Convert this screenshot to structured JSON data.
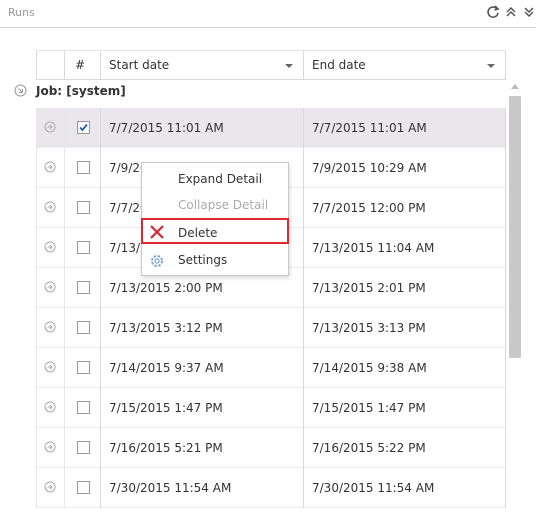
{
  "header": {
    "title": "Runs",
    "icons": [
      "refresh-icon",
      "collapse-all-icon",
      "expand-all-icon"
    ]
  },
  "columns": {
    "num": "#",
    "start_date": "Start date",
    "end_date": "End date"
  },
  "group": {
    "label": "Job: [system]"
  },
  "rows": [
    {
      "start": "7/7/2015 11:01 AM",
      "end": "7/7/2015 11:01 AM",
      "checked": true,
      "selected": true
    },
    {
      "start": "7/9/2015 10:29 AM",
      "end": "7/9/2015 10:29 AM",
      "checked": false
    },
    {
      "start": "7/7/2015 12:00 PM",
      "end": "7/7/2015 12:00 PM",
      "checked": false
    },
    {
      "start": "7/13/2015 11:04 AM",
      "end": "7/13/2015 11:04 AM",
      "checked": false
    },
    {
      "start": "7/13/2015 2:00 PM",
      "end": "7/13/2015 2:01 PM",
      "checked": false
    },
    {
      "start": "7/13/2015 3:12 PM",
      "end": "7/13/2015 3:13 PM",
      "checked": false
    },
    {
      "start": "7/14/2015 9:37 AM",
      "end": "7/14/2015 9:38 AM",
      "checked": false
    },
    {
      "start": "7/15/2015 1:47 PM",
      "end": "7/15/2015 1:47 PM",
      "checked": false
    },
    {
      "start": "7/16/2015 5:21 PM",
      "end": "7/16/2015 5:22 PM",
      "checked": false
    },
    {
      "start": "7/30/2015 11:54 AM",
      "end": "7/30/2015 11:54 AM",
      "checked": false
    }
  ],
  "context_menu": {
    "items": [
      {
        "label": "Expand Detail",
        "disabled": false
      },
      {
        "label": "Collapse Detail",
        "disabled": true
      },
      {
        "label": "Delete",
        "icon": "delete-x-icon",
        "highlighted": true
      },
      {
        "label": "Settings",
        "icon": "gear-icon"
      }
    ]
  },
  "colors": {
    "selected_row": "#eae7ec",
    "highlight_border": "#e0262f",
    "delete_icon": "#d9262e"
  }
}
